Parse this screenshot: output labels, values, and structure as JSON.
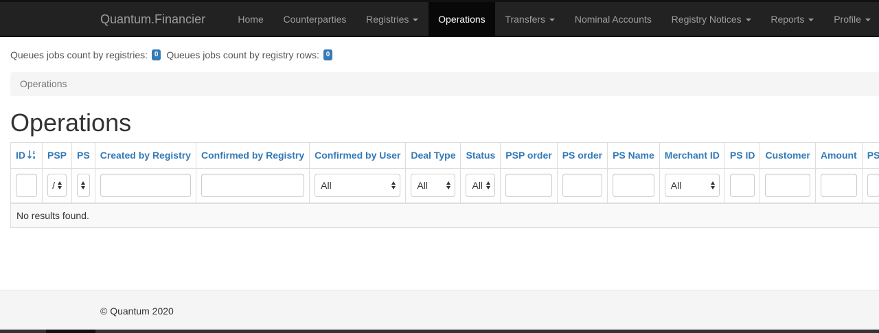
{
  "app": {
    "brand": "Quantum.Financier"
  },
  "nav": {
    "items": [
      {
        "label": "Home",
        "dropdown": false,
        "active": false
      },
      {
        "label": "Counterparties",
        "dropdown": false,
        "active": false
      },
      {
        "label": "Registries",
        "dropdown": true,
        "active": false
      },
      {
        "label": "Operations",
        "dropdown": false,
        "active": true
      },
      {
        "label": "Transfers",
        "dropdown": true,
        "active": false
      },
      {
        "label": "Nominal Accounts",
        "dropdown": false,
        "active": false
      },
      {
        "label": "Registry Notices",
        "dropdown": true,
        "active": false
      },
      {
        "label": "Reports",
        "dropdown": true,
        "active": false
      },
      {
        "label": "Profile",
        "dropdown": true,
        "active": false
      }
    ]
  },
  "queues": {
    "registries_label": "Queues jobs count by registries:",
    "registries_count": "0",
    "rows_label": "Queues jobs count by registry rows:",
    "rows_count": "0"
  },
  "breadcrumb": {
    "current": "Operations"
  },
  "page": {
    "title": "Operations"
  },
  "table": {
    "columns": [
      {
        "label": "ID",
        "filter": "input",
        "sort_icon": "sort-alpha-icon"
      },
      {
        "label": "PSP",
        "filter": "select",
        "value": "/"
      },
      {
        "label": "PS",
        "filter": "select",
        "value": ""
      },
      {
        "label": "Created by Registry",
        "filter": "input"
      },
      {
        "label": "Confirmed by Registry",
        "filter": "input"
      },
      {
        "label": "Confirmed by User",
        "filter": "select",
        "value": "All"
      },
      {
        "label": "Deal Type",
        "filter": "select",
        "value": "All"
      },
      {
        "label": "Status",
        "filter": "select",
        "value": "All"
      },
      {
        "label": "PSP order",
        "filter": "input"
      },
      {
        "label": "PS order",
        "filter": "input"
      },
      {
        "label": "PS Name",
        "filter": "input"
      },
      {
        "label": "Merchant ID",
        "filter": "select",
        "value": "All"
      },
      {
        "label": "PS ID",
        "filter": "input"
      },
      {
        "label": "Customer",
        "filter": "input"
      },
      {
        "label": "Amount",
        "filter": "input"
      },
      {
        "label": "PS",
        "filter": "input"
      }
    ],
    "empty_message": "No results found."
  },
  "footer": {
    "copyright": "© Quantum 2020"
  },
  "colors": {
    "navbar": "#222222",
    "link": "#337ab7",
    "badge": "#337ab7"
  }
}
